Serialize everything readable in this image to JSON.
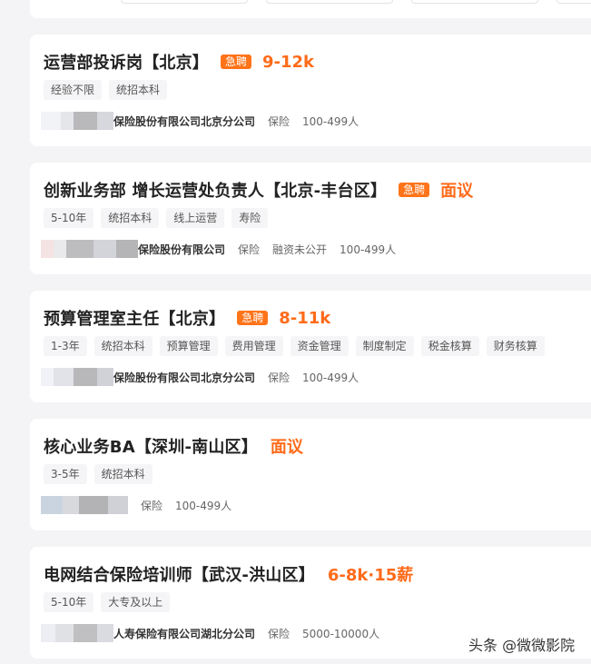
{
  "colors": {
    "accent_orange": "#ff6b1a",
    "urgent_badge": "#ff7319",
    "card_bg": "#ffffff",
    "page_bg": "#f4f4f6"
  },
  "jobs": [
    {
      "title": "运营部投诉岗【北京】",
      "urgent": "急聘",
      "salary": "9-12k",
      "tags": [
        "经验不限",
        "统招本科"
      ],
      "company": "保险股份有限公司北京分公司",
      "industry": "保险",
      "funding": "",
      "size": "100-499人"
    },
    {
      "title": "创新业务部 增长运营处负责人【北京-丰台区】",
      "urgent": "急聘",
      "salary": "面议",
      "tags": [
        "5-10年",
        "统招本科",
        "线上运营",
        "寿险"
      ],
      "company": "保险股份有限公司",
      "industry": "保险",
      "funding": "融资未公开",
      "size": "100-499人"
    },
    {
      "title": "预算管理室主任【北京】",
      "urgent": "急聘",
      "salary": "8-11k",
      "tags": [
        "1-3年",
        "统招本科",
        "预算管理",
        "费用管理",
        "资金管理",
        "制度制定",
        "税金核算",
        "财务核算"
      ],
      "company": "保险股份有限公司北京分公司",
      "industry": "保险",
      "funding": "",
      "size": "100-499人"
    },
    {
      "title": "核心业务BA【深圳-南山区】",
      "urgent": "",
      "salary": "面议",
      "tags": [
        "3-5年",
        "统招本科"
      ],
      "company": "",
      "industry": "保险",
      "funding": "",
      "size": "100-499人"
    },
    {
      "title": "电网结合保险培训师【武汉-洪山区】",
      "urgent": "",
      "salary": "6-8k·15薪",
      "tags": [
        "5-10年",
        "大专及以上"
      ],
      "company": "人寿保险有限公司湖北分公司",
      "industry": "保险",
      "funding": "",
      "size": "5000-10000人"
    }
  ],
  "watermark": "头条 @微微影院"
}
